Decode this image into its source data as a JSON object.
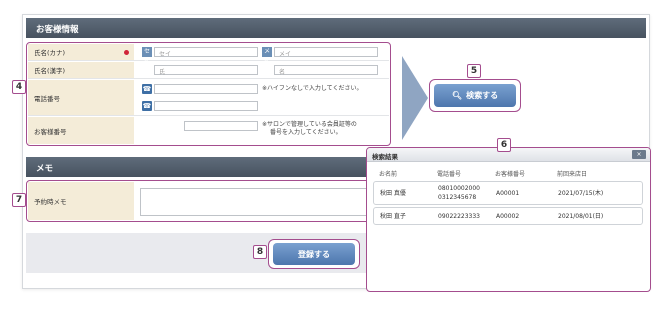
{
  "section_customer": {
    "title": "お客様情報"
  },
  "form": {
    "kana": {
      "label": "氏名(カナ)",
      "sei_icon": "セイ",
      "mei_icon": "メイ",
      "sei_placeholder": "セイ",
      "mei_placeholder": "メイ"
    },
    "kanji": {
      "label": "氏名(漢字)",
      "sei_placeholder": "氏",
      "mei_placeholder": "名"
    },
    "phone": {
      "label": "電話番号",
      "note": "※ハイフンなしで入力してください。"
    },
    "customer_no": {
      "label": "お客様番号",
      "note_line1": "※サロンで管理している会員証等の",
      "note_line2": "番号を入力してください。"
    }
  },
  "search": {
    "button_label": "検索する",
    "icon": "search-icon"
  },
  "section_memo": {
    "title": "メモ"
  },
  "memo": {
    "label": "予約時メモ"
  },
  "register": {
    "button_label": "登録する"
  },
  "badges": {
    "b4": "4",
    "b5": "5",
    "b6": "6",
    "b7": "7",
    "b8": "8"
  },
  "results": {
    "title": "検索結果",
    "close": "×",
    "columns": [
      "お名前",
      "電話番号",
      "お客様番号",
      "前回来店日"
    ],
    "rows": [
      {
        "name": "秋田 真優",
        "phone1": "08010002000",
        "phone2": "0312345678",
        "customer_no": "A00001",
        "last_visit": "2021/07/15(木)"
      },
      {
        "name": "秋田 直子",
        "phone1": "09022223333",
        "phone2": "",
        "customer_no": "A00002",
        "last_visit": "2021/08/01(日)"
      }
    ]
  },
  "colors": {
    "accent_outline": "#a44d8e",
    "button_blue": "#4d76ad",
    "required_dot": "#d0253a",
    "label_bg": "#f4ecd8"
  }
}
